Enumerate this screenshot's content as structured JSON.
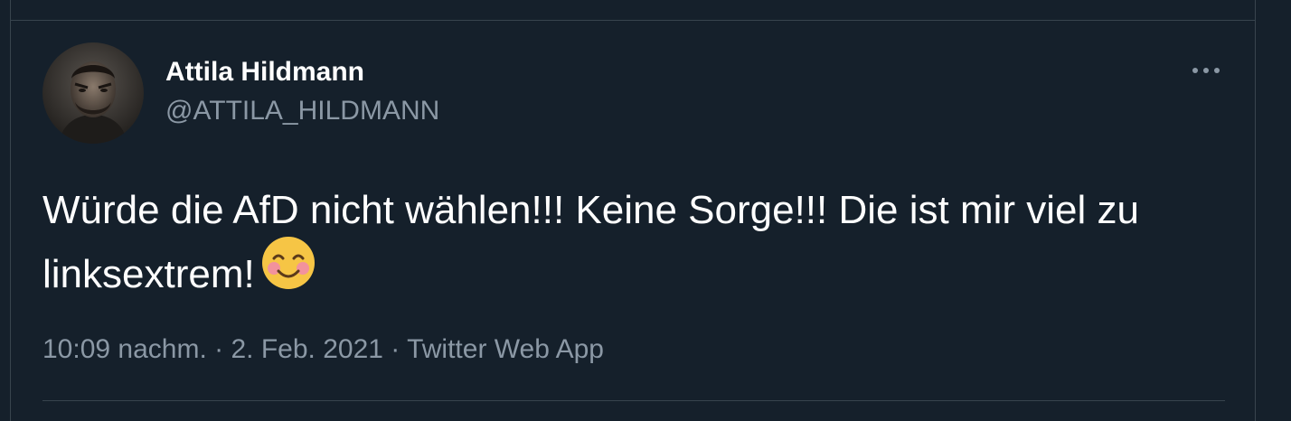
{
  "tweet": {
    "author_name": "Attila Hildmann",
    "author_handle": "@ATTILA_HILDMANN",
    "text": "Würde die AfD nicht wählen!!! Keine Sorge!!! Die ist mir viel zu linksextrem!",
    "emoji": "smiling-face-with-smiling-eyes",
    "time": "10:09 nachm.",
    "separator": "·",
    "date": "2. Feb. 2021",
    "source": "Twitter Web App",
    "more_icon": "more-horizontal-icon"
  },
  "colors": {
    "background": "#15202b",
    "border": "#38444d",
    "primary_text": "#ffffff",
    "secondary_text": "#8b98a5"
  }
}
